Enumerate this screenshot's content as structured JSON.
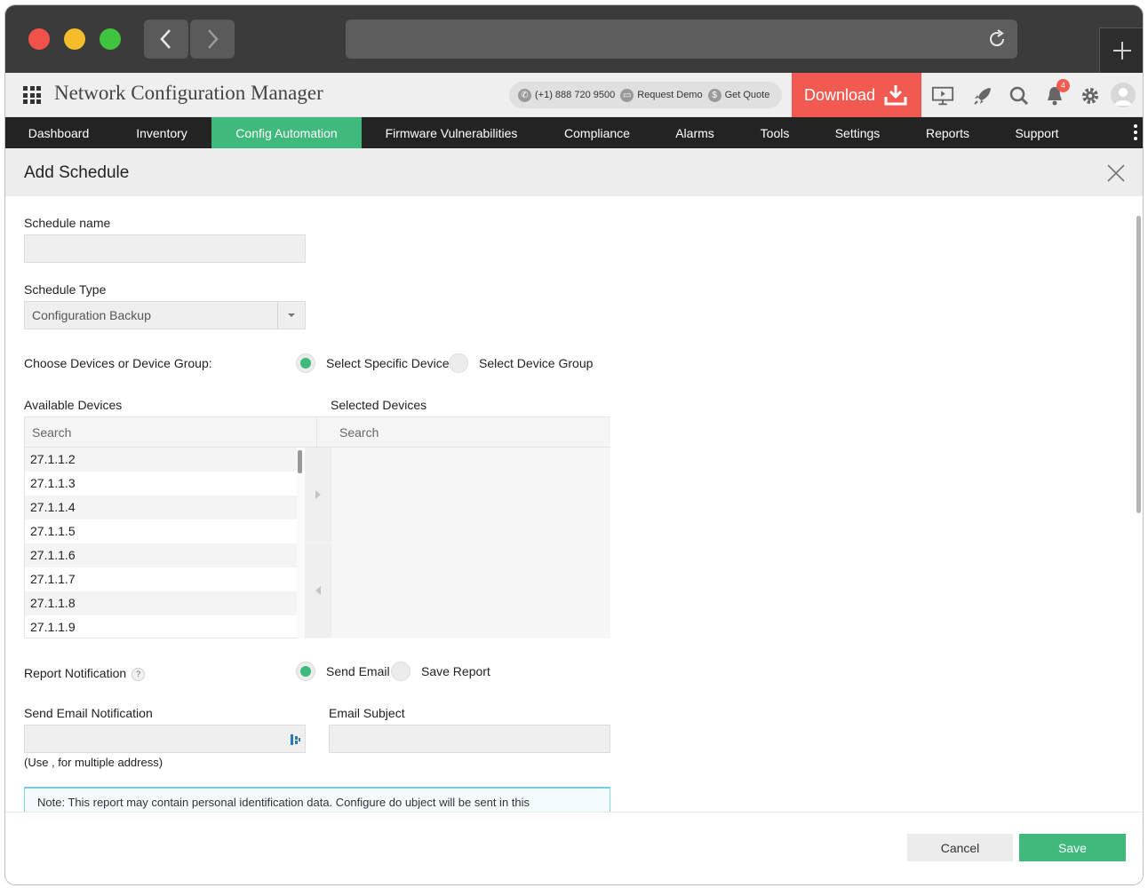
{
  "browser": {
    "back_icon": "chevron-left-icon",
    "forward_icon": "chevron-right-icon",
    "reload_icon": "reload-icon",
    "new_tab_icon": "plus-icon"
  },
  "app": {
    "title": "Network Configuration Manager",
    "phone": "(+1) 888 720 9500",
    "request_demo": "Request Demo",
    "get_quote": "Get Quote",
    "download_label": "Download",
    "notification_count": "4",
    "accent_color": "#3fb97c",
    "download_color": "#f15a50"
  },
  "nav": {
    "items": [
      {
        "label": "Dashboard"
      },
      {
        "label": "Inventory"
      },
      {
        "label": "Config Automation"
      },
      {
        "label": "Firmware Vulnerabilities"
      },
      {
        "label": "Compliance"
      },
      {
        "label": "Alarms"
      },
      {
        "label": "Tools"
      },
      {
        "label": "Settings"
      },
      {
        "label": "Reports"
      },
      {
        "label": "Support"
      }
    ],
    "active": "Config Automation"
  },
  "dialog": {
    "title": "Add Schedule",
    "schedule_name_label": "Schedule name",
    "schedule_name_value": "",
    "schedule_type_label": "Schedule Type",
    "schedule_type_value": "Configuration Backup",
    "choose_label": "Choose Devices or Device Group:",
    "radio_specific": "Select Specific Device",
    "radio_group": "Select Device Group",
    "available_label": "Available Devices",
    "selected_label": "Selected Devices",
    "search_placeholder_left": "Search",
    "search_placeholder_right": "Search",
    "devices": [
      "27.1.1.2",
      "27.1.1.3",
      "27.1.1.4",
      "27.1.1.5",
      "27.1.1.6",
      "27.1.1.7",
      "27.1.1.8",
      "27.1.1.9"
    ],
    "report_notification_label": "Report Notification",
    "help_mark": "?",
    "radio_send_email": "Send Email",
    "radio_save_report": "Save Report",
    "send_email_label": "Send Email Notification",
    "email_subject_label": "Email Subject",
    "email_hint": "(Use , for multiple address)",
    "note_text": "Note: This report may contain personal identification data. Configure do ubject will be sent in this",
    "cancel_label": "Cancel",
    "save_label": "Save"
  }
}
